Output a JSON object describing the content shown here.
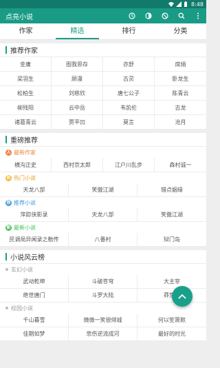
{
  "status": {
    "time": "8:48"
  },
  "app": {
    "title": "点亮小说"
  },
  "tabs": [
    "作家",
    "精选",
    "排行",
    "分类"
  ],
  "authors": {
    "title": "推荐作家",
    "names": [
      "金庸",
      "图我思存",
      "亦舒",
      "席绢",
      "梁羽生",
      "顾漫",
      "古灵",
      "卧龙生",
      "松柏生",
      "刘慈欣",
      "唐七公子",
      "陈青云",
      "柳残阳",
      "云中岳",
      "韦凯伦",
      "古龙",
      "诸葛青云",
      "贾平凹",
      "莫言",
      "沧月"
    ]
  },
  "heavy": {
    "title": "重磅推荐",
    "newest_author": {
      "label": "最新作家",
      "names": [
        "横沟正史",
        "西村京太郎",
        "江户川乱步",
        "森村诚一"
      ]
    },
    "hot": {
      "label": "热门小说",
      "names": [
        "天龙八部",
        "笑傲江湖",
        "错点姻缘"
      ]
    },
    "recommend": {
      "label": "推荐小说",
      "names": [
        "萍踪侠影录",
        "天龙八部",
        "笑傲江湖"
      ]
    },
    "newest_novel": {
      "label": "最新小说",
      "names": [
        "民调局异闻录之勒传",
        "八番村",
        "狱门岛"
      ]
    }
  },
  "ranking": {
    "title": "小说风云榜",
    "sections": [
      {
        "label": "玄幻小说",
        "names": [
          "武动乾坤",
          "斗破苍穹",
          "大主宰",
          "绝世唐门",
          "斗罗大陆",
          "莽荒纪"
        ]
      },
      {
        "label": "校园小说",
        "names": [
          "千山暮雪",
          "微微一笑很倾城",
          "何以笙箫默",
          "佳期如梦",
          "悲伤逆流成河",
          "最好的时光"
        ]
      }
    ]
  },
  "colors": {
    "primary": "#199b86",
    "badge_orange": "#f0853c",
    "badge_yellow": "#f0b429",
    "badge_blue": "#3b9be0",
    "badge_green": "#3fbf5c"
  }
}
